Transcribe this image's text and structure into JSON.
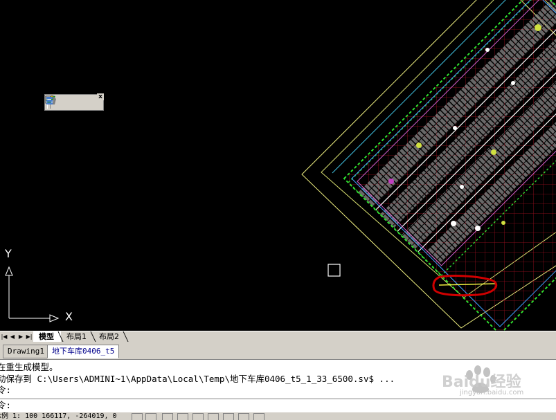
{
  "canvas": {
    "background": "#000000",
    "ucs": {
      "y_label": "Y",
      "x_label": "X"
    },
    "annotation_color": "#cc0000"
  },
  "toolbar": {
    "buttons": [
      {
        "icon": "properties-icon"
      },
      {
        "icon": "checkmark-icon"
      },
      {
        "icon": "layer-icon"
      }
    ],
    "close_label": "x"
  },
  "layout_tabs": {
    "tabs": [
      {
        "label": "模型",
        "active": true
      },
      {
        "label": "布局1",
        "active": false
      },
      {
        "label": "布局2",
        "active": false
      }
    ]
  },
  "doc_tabs": {
    "tabs": [
      {
        "label": "Drawing1",
        "active": false
      },
      {
        "label": "地下车库0406_t5",
        "active": true
      }
    ]
  },
  "command": {
    "lines": [
      "在重生成模型。",
      "动保存到 C:\\Users\\ADMINI~1\\AppData\\Local\\Temp\\地下车库0406_t5_1_33_6500.sv$ ...",
      "令:"
    ],
    "prompt": "令:"
  },
  "watermark": {
    "text": "Baidu经验",
    "subtext": "jingyan.baidu.com"
  },
  "status_bar": {
    "coords": "k例 1: 100    166117, -264019, 0"
  }
}
